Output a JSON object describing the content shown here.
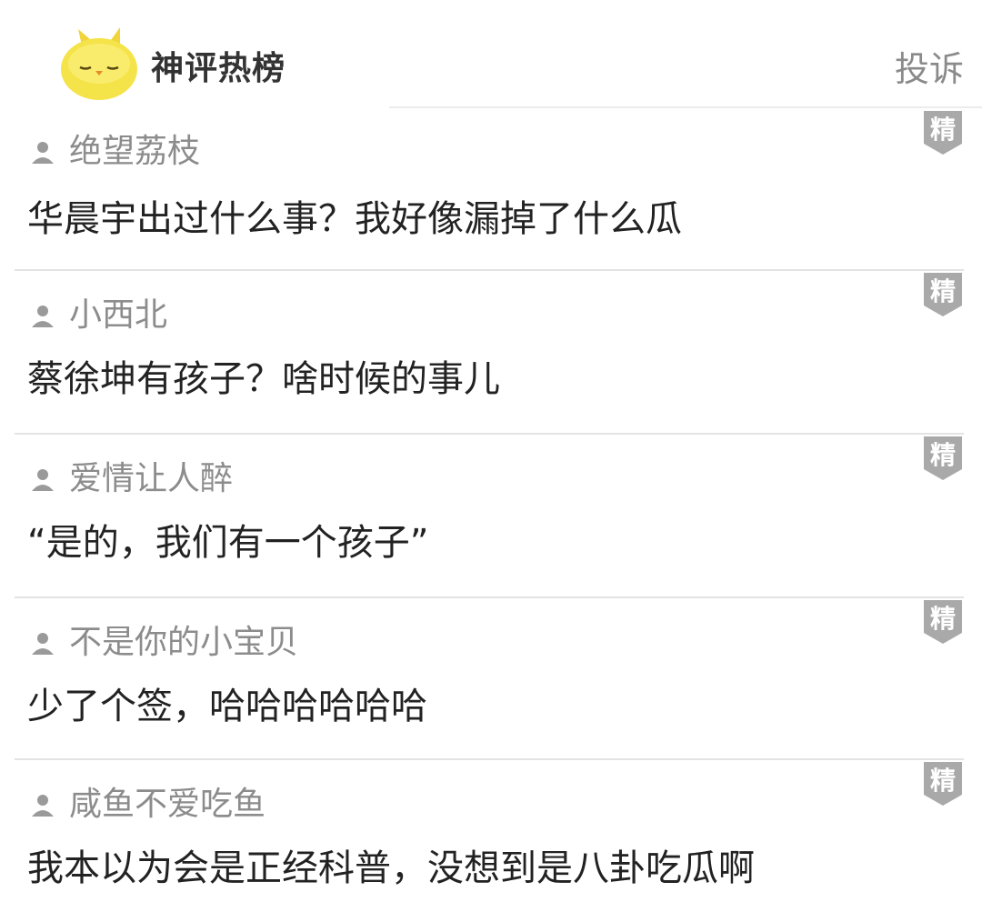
{
  "header": {
    "title": "神评热榜",
    "report_label": "投诉",
    "mascot_icon": "chick-mascot-icon"
  },
  "badge_label": "精",
  "colors": {
    "badge": "#a9a9a9",
    "username": "#8c8c8c",
    "comment_text": "#222222",
    "mascot": "#f5e34a"
  },
  "comments": [
    {
      "username": "绝望荔枝",
      "text": "华晨宇出过什么事？我好像漏掉了什么瓜"
    },
    {
      "username": "小西北",
      "text": "蔡徐坤有孩子？啥时候的事儿"
    },
    {
      "username": "爱情让人醉",
      "text": "“是的，我们有一个孩子”"
    },
    {
      "username": "不是你的小宝贝",
      "text": "少了个签，哈哈哈哈哈哈"
    },
    {
      "username": "咸鱼不爱吃鱼",
      "text": "我本以为会是正经科普，没想到是八卦吃瓜啊"
    }
  ]
}
